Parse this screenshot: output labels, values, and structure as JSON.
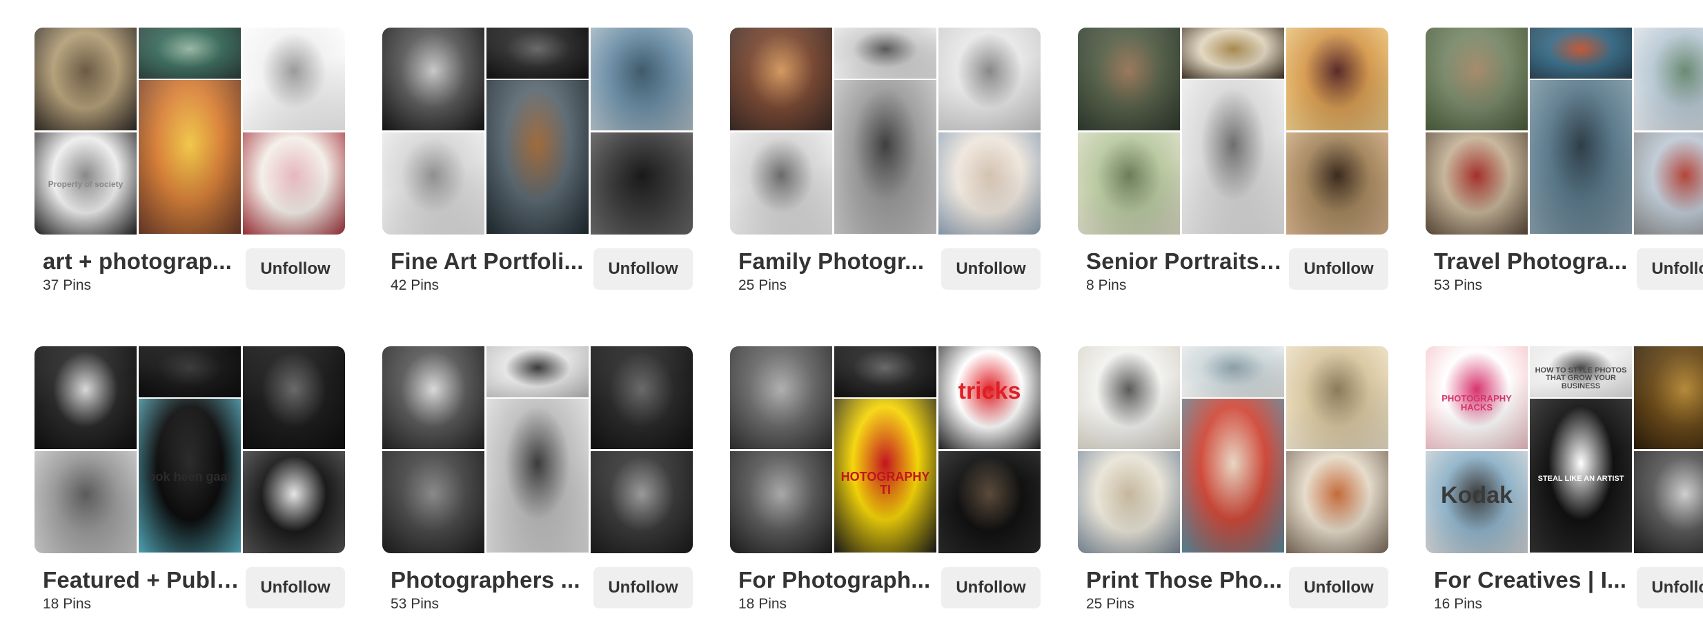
{
  "button_label": "Unfollow",
  "boards": [
    {
      "title": "art + photograp...",
      "pins": "37 Pins",
      "tiles": [
        {
          "name": "collage-face-photo",
          "colors": [
            "#b5a07a",
            "#6b5b45",
            "#2f2a26"
          ]
        },
        {
          "name": "collage-suits-photo",
          "colors": [
            "#3f6f60",
            "#9ab8a6",
            "#2d3e3a"
          ]
        },
        {
          "name": "stripes-pattern-art",
          "colors": [
            "#f2f2f2",
            "#9a9a9a",
            "#ffffff"
          ]
        },
        {
          "name": "barcode-portrait-photo",
          "colors": [
            "#eeeeee",
            "#888888",
            "#222222"
          ],
          "caption": "Property of society"
        },
        {
          "name": "sunset-collage-art",
          "colors": [
            "#d9823a",
            "#f0c84b",
            "#6b3b2a"
          ]
        },
        {
          "name": "pink-burst-art",
          "colors": [
            "#f4efe9",
            "#e6b7bd",
            "#a4313a"
          ]
        }
      ]
    },
    {
      "title": "Fine Art Portfoli...",
      "pins": "42 Pins",
      "tiles": [
        {
          "name": "flower-hair-portrait-photo",
          "colors": [
            "#5c5c5c",
            "#c8c8c8",
            "#151515"
          ]
        },
        {
          "name": "dark-profile-photo",
          "colors": [
            "#2f2f2f",
            "#6b6b6b",
            "#111111"
          ]
        },
        {
          "name": "van-window-photo",
          "colors": [
            "#6d8fa7",
            "#3f5a6a",
            "#b5c4cc"
          ]
        },
        {
          "name": "ocean-swimmer-photo",
          "colors": [
            "#d8d8d8",
            "#8f8f8f",
            "#f0f0f0"
          ]
        },
        {
          "name": "eye-closeup-photo",
          "colors": [
            "#5c6a73",
            "#a06a3c",
            "#1f2a30"
          ]
        },
        {
          "name": "underwater-girl-photo",
          "colors": [
            "#3b3b3b",
            "#191919",
            "#6a6a6a"
          ]
        }
      ]
    },
    {
      "title": "Family Photogr...",
      "pins": "25 Pins",
      "tiles": [
        {
          "name": "family-couch-photo",
          "colors": [
            "#7a4a35",
            "#d49a62",
            "#3a2b26"
          ]
        },
        {
          "name": "family-laughing-photo",
          "colors": [
            "#cfcfcf",
            "#5a5a5a",
            "#eeeeee"
          ]
        },
        {
          "name": "mother-baby-photo",
          "colors": [
            "#e8e8e8",
            "#888888",
            "#cccccc"
          ]
        },
        {
          "name": "kitchen-sink-photo",
          "colors": [
            "#d6d6d6",
            "#6a6a6a",
            "#f2f2f2"
          ]
        },
        {
          "name": "parent-child-photo",
          "colors": [
            "#9c9c9c",
            "#3e3e3e",
            "#d0d0d0"
          ]
        },
        {
          "name": "beach-kids-photo",
          "colors": [
            "#efe7de",
            "#d3c2b1",
            "#8ea2b6"
          ]
        }
      ]
    },
    {
      "title": "Senior Portraits ...",
      "pins": "8 Pins",
      "tiles": [
        {
          "name": "senior-sitting-photo",
          "colors": [
            "#56614a",
            "#9b7a5d",
            "#2e3a2f"
          ]
        },
        {
          "name": "senior-smile-photo",
          "colors": [
            "#e3d8c2",
            "#a6894f",
            "#403425"
          ]
        },
        {
          "name": "senior-sunlight-photo",
          "colors": [
            "#d69c52",
            "#5a2a2a",
            "#f0d08c"
          ]
        },
        {
          "name": "senior-fence-photo",
          "colors": [
            "#b9c9a1",
            "#6c7c5a",
            "#e2e0cc"
          ]
        },
        {
          "name": "friends-laughing-photo",
          "colors": [
            "#d9d9d9",
            "#6e6e6e",
            "#f3f3f3"
          ]
        },
        {
          "name": "senior-hat-photo",
          "colors": [
            "#a4875f",
            "#3b2a1e",
            "#d9b58f"
          ]
        }
      ]
    },
    {
      "title": "Travel Photogra...",
      "pins": "53 Pins",
      "tiles": [
        {
          "name": "village-child-photo",
          "colors": [
            "#7a8a6b",
            "#a58c6d",
            "#4a5c3a"
          ]
        },
        {
          "name": "market-boats-photo",
          "colors": [
            "#3c6f8a",
            "#c25a3a",
            "#2a4150"
          ]
        },
        {
          "name": "mountain-valley-photo",
          "colors": [
            "#b9c9d4",
            "#6a8a73",
            "#e8ecef"
          ]
        },
        {
          "name": "street-kids-photo",
          "colors": [
            "#c6b59a",
            "#a3302a",
            "#5a4a3a"
          ]
        },
        {
          "name": "river-street-photo",
          "colors": [
            "#5b7a8c",
            "#2e3e48",
            "#8ca3b0"
          ]
        },
        {
          "name": "bicycle-rider-photo",
          "colors": [
            "#bfcbd6",
            "#b3453a",
            "#8c8c8c"
          ]
        }
      ]
    },
    {
      "title": "Featured + Publi...",
      "pins": "18 Pins",
      "tiles": [
        {
          "name": "framed-child-photo",
          "colors": [
            "#2a2a2a",
            "#d9d9d9",
            "#0f0f0f"
          ]
        },
        {
          "name": "dark-forest-photo",
          "colors": [
            "#1b1b1b",
            "#3d3d3d",
            "#0c0c0c"
          ]
        },
        {
          "name": "face-closeup-photo",
          "colors": [
            "#1e1e1e",
            "#6a6a6a",
            "#0e0e0e"
          ]
        },
        {
          "name": "blonde-woman-photo",
          "colors": [
            "#9a9a9a",
            "#5a5a5a",
            "#d0d0d0"
          ]
        },
        {
          "name": "book-cover-photo",
          "colors": [
            "#0d0d0d",
            "#2b2b2b",
            "#58b4c6"
          ],
          "caption": "ook heen gaat"
        },
        {
          "name": "print-cards-photo",
          "colors": [
            "#1a1a1a",
            "#e6e6e6",
            "#555555"
          ]
        }
      ]
    },
    {
      "title": "Photographers ...",
      "pins": "53 Pins",
      "tiles": [
        {
          "name": "light-beam-photo",
          "colors": [
            "#5a5a5a",
            "#d9d9d9",
            "#222222"
          ]
        },
        {
          "name": "triangle-wall-photo",
          "colors": [
            "#e6e6e6",
            "#3a3a3a",
            "#bcbcbc"
          ]
        },
        {
          "name": "street-stairs-photo",
          "colors": [
            "#2a2a2a",
            "#6a6a6a",
            "#111111"
          ]
        },
        {
          "name": "crowd-street-photo",
          "colors": [
            "#4a4a4a",
            "#8a8a8a",
            "#1c1c1c"
          ]
        },
        {
          "name": "beach-play-photo",
          "colors": [
            "#bdbdbd",
            "#3a3a3a",
            "#e6e6e6"
          ]
        },
        {
          "name": "old-man-window-photo",
          "colors": [
            "#3a3a3a",
            "#9a9a9a",
            "#1a1a1a"
          ]
        }
      ]
    },
    {
      "title": "For Photograph...",
      "pins": "18 Pins",
      "tiles": [
        {
          "name": "ruins-landscape-photo",
          "colors": [
            "#6a6a6a",
            "#b0b0b0",
            "#2e2e2e"
          ]
        },
        {
          "name": "fern-portrait-photo",
          "colors": [
            "#2a2a2a",
            "#6a6a6a",
            "#0f0f0f"
          ]
        },
        {
          "name": "tricks-poster-photo",
          "colors": [
            "#ffffff",
            "#e01f26",
            "#222222"
          ],
          "caption": "tricks"
        },
        {
          "name": "street-men-photo",
          "colors": [
            "#5a5a5a",
            "#a9a9a9",
            "#1e1e1e"
          ]
        },
        {
          "name": "photography-tips-poster",
          "colors": [
            "#f5d60a",
            "#c2141f",
            "#1a1a1a"
          ],
          "caption": "HOTOGRAPHY TI"
        },
        {
          "name": "dried-flower-photo",
          "colors": [
            "#111111",
            "#5a4a3a",
            "#2a2a2a"
          ]
        }
      ]
    },
    {
      "title": "Print Those Pho...",
      "pins": "25 Pins",
      "tiles": [
        {
          "name": "framed-wall-photo",
          "colors": [
            "#f2f2f0",
            "#5a5a5a",
            "#d9d4c8"
          ]
        },
        {
          "name": "gallery-wall-photo",
          "colors": [
            "#cfd9dc",
            "#8a9ea6",
            "#f0f0ee"
          ]
        },
        {
          "name": "polaroid-wall-photo",
          "colors": [
            "#d9c7a1",
            "#8a7a5a",
            "#f2e8d0"
          ]
        },
        {
          "name": "bedroom-prints-photo",
          "colors": [
            "#e9e4d8",
            "#c4b79c",
            "#7a8a9a"
          ]
        },
        {
          "name": "photo-grid-sofa-photo",
          "colors": [
            "#d04a3a",
            "#e8d6c4",
            "#5a8fa3"
          ]
        },
        {
          "name": "living-room-frames-photo",
          "colors": [
            "#e6dccb",
            "#c46a3a",
            "#7a6a5a"
          ]
        }
      ]
    },
    {
      "title": "For Creatives | I...",
      "pins": "16 Pins",
      "tiles": [
        {
          "name": "photography-hacks-pin",
          "colors": [
            "#ffffff",
            "#d6336c",
            "#f4c2c8"
          ],
          "caption": "PHOTOGRAPHY HACKS"
        },
        {
          "name": "style-photos-pin",
          "colors": [
            "#f2f2f2",
            "#4a4a4a",
            "#e6e6e6"
          ],
          "caption": "HOW TO STYLE PHOTOS THAT GROW YOUR BUSINESS"
        },
        {
          "name": "curtain-stage-photo",
          "colors": [
            "#6a4a1a",
            "#b58a3a",
            "#2a1c0a"
          ]
        },
        {
          "name": "vintage-camera-photo",
          "colors": [
            "#8fb3c9",
            "#3a3a3a",
            "#d9d9d9"
          ],
          "caption": "Kodak"
        },
        {
          "name": "steal-like-artist-pin",
          "colors": [
            "#111111",
            "#ffffff",
            "#333333"
          ],
          "caption": "STEAL LIKE AN ARTIST"
        },
        {
          "name": "man-camera-photo",
          "colors": [
            "#5a5a5a",
            "#cfcfcf",
            "#1e1e1e"
          ]
        }
      ]
    }
  ]
}
